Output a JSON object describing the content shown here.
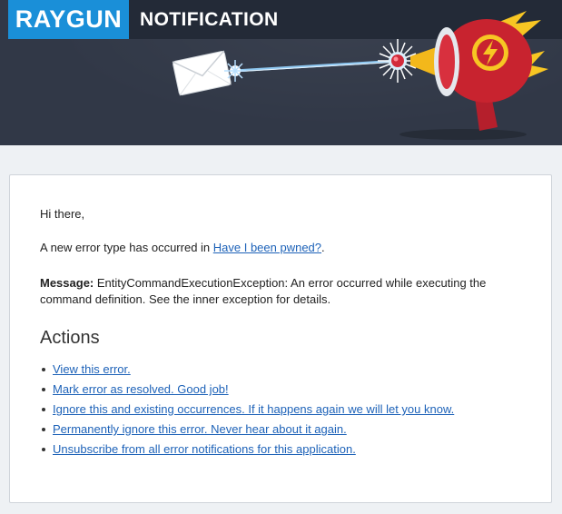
{
  "header": {
    "logo": "RAYGUN",
    "title": "NOTIFICATION"
  },
  "email": {
    "greeting": "Hi there,",
    "new_error_prefix": "A new error type has occurred in ",
    "app_link": "Have I been pwned?",
    "new_error_suffix": ".",
    "message_label": "Message:",
    "message_text": " EntityCommandExecutionException: An error occurred while executing the command definition. See the inner exception for details."
  },
  "actions": {
    "heading": "Actions",
    "items": [
      "View this error.",
      "Mark error as resolved. Good job!",
      "Ignore this and existing occurrences. If it happens again we will let you know.",
      "Permanently ignore this error. Never hear about it again.",
      "Unsubscribe from all error notifications for this application."
    ]
  },
  "colors": {
    "header_bg": "#313847",
    "brand_blue": "#1a8fd8",
    "link": "#1d62b8"
  }
}
